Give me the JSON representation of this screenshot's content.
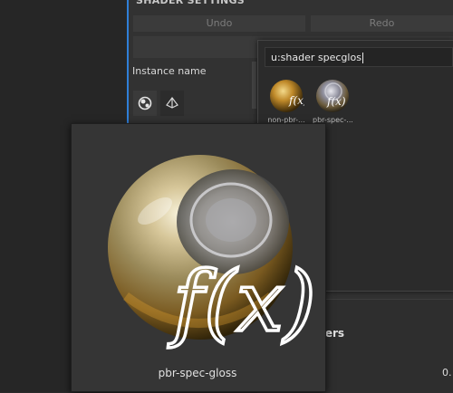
{
  "panel": {
    "title": "SHADER SETTINGS",
    "undo_label": "Undo",
    "redo_label": "Redo",
    "instance_label": "Instance name"
  },
  "search": {
    "value": "u:shader specglos"
  },
  "results": [
    {
      "label": "non-pbr-...",
      "icon": "shader-metal-sphere-icon"
    },
    {
      "label": "pbr-spec-...",
      "icon": "shader-metal-sphere-icon"
    }
  ],
  "preview": {
    "caption": "pbr-spec-gloss",
    "icon": "function-fx-icon"
  },
  "bottom": {
    "heading": "eters",
    "value": "0."
  },
  "colors": {
    "accent": "#2f7fd8",
    "panel_bg": "#323232",
    "preview_bg": "#353535"
  }
}
